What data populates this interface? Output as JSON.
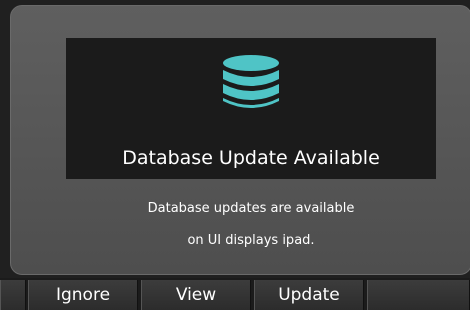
{
  "dialog": {
    "icon": "database-icon",
    "title": "Database Update Available",
    "message_line1": "Database updates are available",
    "message_line2": "on UI displays ipad."
  },
  "softkeys": {
    "ignore_label": "Ignore",
    "view_label": "View",
    "update_label": "Update"
  },
  "colors": {
    "icon_accent": "#4fc4c6",
    "panel_bg": "#575757",
    "banner_bg": "#1b1b1b",
    "text": "#ffffff"
  }
}
